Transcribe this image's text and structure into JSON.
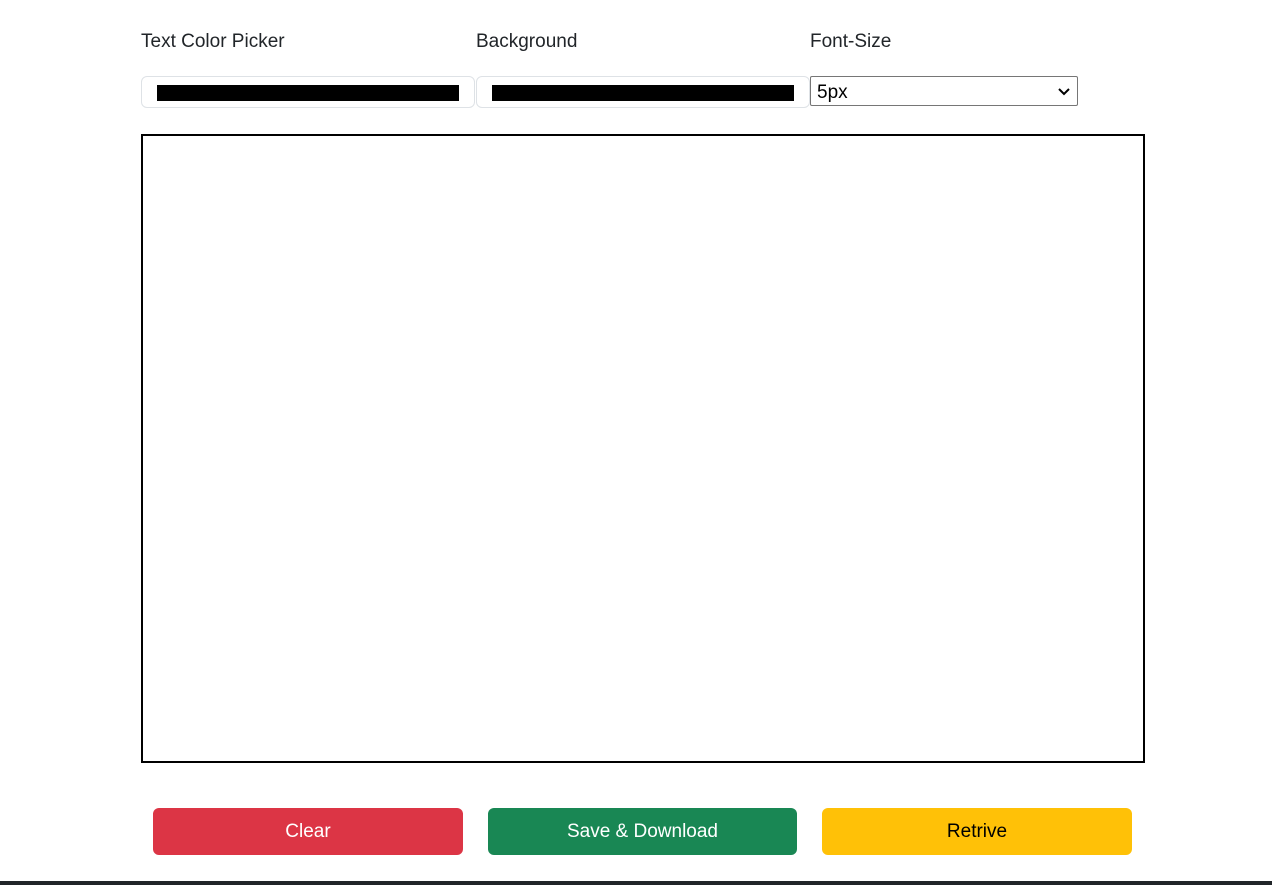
{
  "controls": {
    "text_color_label": "Text Color Picker",
    "text_color_value": "#000000",
    "background_label": "Background",
    "background_value": "#000000",
    "font_size_label": "Font-Size",
    "font_size_value": "5px"
  },
  "buttons": {
    "clear": "Clear",
    "save": "Save & Download",
    "retrieve": "Retrive"
  },
  "colors": {
    "clear_button": "#dc3545",
    "save_button": "#198754",
    "retrieve_button": "#ffc107",
    "canvas_border": "#000000"
  }
}
